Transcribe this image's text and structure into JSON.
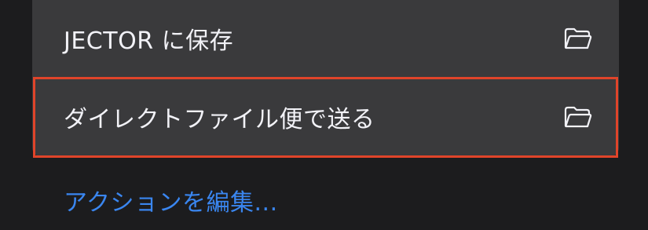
{
  "actions": [
    {
      "label": "JECTOR に保存",
      "icon": "folder-icon"
    },
    {
      "label": "ダイレクトファイル便で送る",
      "icon": "folder-icon"
    }
  ],
  "edit_actions_label": "アクションを編集...",
  "colors": {
    "background": "#1c1c1e",
    "card": "#3a3a3c",
    "text": "#f2f2f7",
    "link": "#3a86f0",
    "highlight_border": "#e0442a"
  }
}
